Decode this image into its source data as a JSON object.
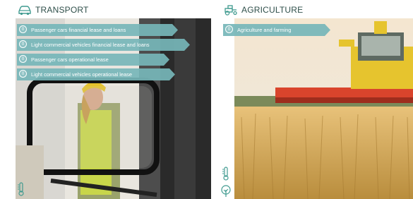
{
  "transport": {
    "title": "TRANSPORT",
    "icon": "car-icon",
    "items": [
      {
        "label": "Passenger cars financial lease and loans",
        "marker": "0"
      },
      {
        "label": "Light commercial vehicles financial lease and loans",
        "marker": "0"
      },
      {
        "label": "Passenger cars operational lease",
        "marker": "0"
      },
      {
        "label": "Light commercial vehicles operational lease",
        "marker": "0"
      }
    ],
    "photo": "forklift-operator-photo",
    "bottom_icons": [
      "thermometer-icon"
    ]
  },
  "agriculture": {
    "title": "AGRICULTURE",
    "icon": "tractor-icon",
    "items": [
      {
        "label": "Agriculture and farming",
        "marker": "0"
      }
    ],
    "photo": "combine-harvester-wheat-photo",
    "bottom_icons": [
      "thermometer-icon",
      "tree-icon"
    ]
  },
  "colors": {
    "accent": "#76b6b9",
    "icon": "#3f9a8f",
    "title": "#2f4f4a"
  }
}
